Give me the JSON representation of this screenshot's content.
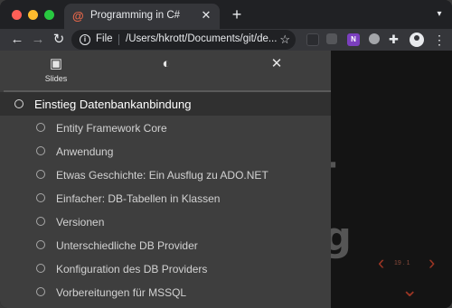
{
  "browser": {
    "tab_title": "Programming in C#",
    "tab_favicon": "@",
    "new_tab_symbol": "+",
    "scheme_label": "File",
    "url": "/Users/hkrott/Documents/git/de...",
    "extensions": [
      "extension-icon",
      "extension-icon",
      "onenote-icon",
      "extension-icon"
    ],
    "onenote_label": "N"
  },
  "panel": {
    "tabs": [
      {
        "label": "Slides",
        "icon": "slides-icon"
      },
      {
        "label": "",
        "icon": "theme-icon"
      },
      {
        "label": "",
        "icon": "close-icon"
      }
    ],
    "toc": [
      {
        "label": "Einstieg Datenbankanbindung",
        "level": 1,
        "active": true
      },
      {
        "label": "Entity Framework Core",
        "level": 2
      },
      {
        "label": "Anwendung",
        "level": 2
      },
      {
        "label": "Etwas Geschichte: Ein Ausflug zu ADO.NET",
        "level": 2
      },
      {
        "label": "Einfacher: DB-Tabellen in Klassen",
        "level": 2
      },
      {
        "label": "Versionen",
        "level": 2
      },
      {
        "label": "Unterschiedliche DB Provider",
        "level": 2
      },
      {
        "label": "Konfiguration des DB Providers",
        "level": 2
      },
      {
        "label": "Vorbereitungen für MSSQL",
        "level": 2
      }
    ]
  },
  "slide": {
    "title_fragment": "k-\nng",
    "counter": "19 . 1"
  },
  "colors": {
    "accent": "#9a3524",
    "panel_bg": "#3e3e3e",
    "active_row_bg": "#303030"
  }
}
